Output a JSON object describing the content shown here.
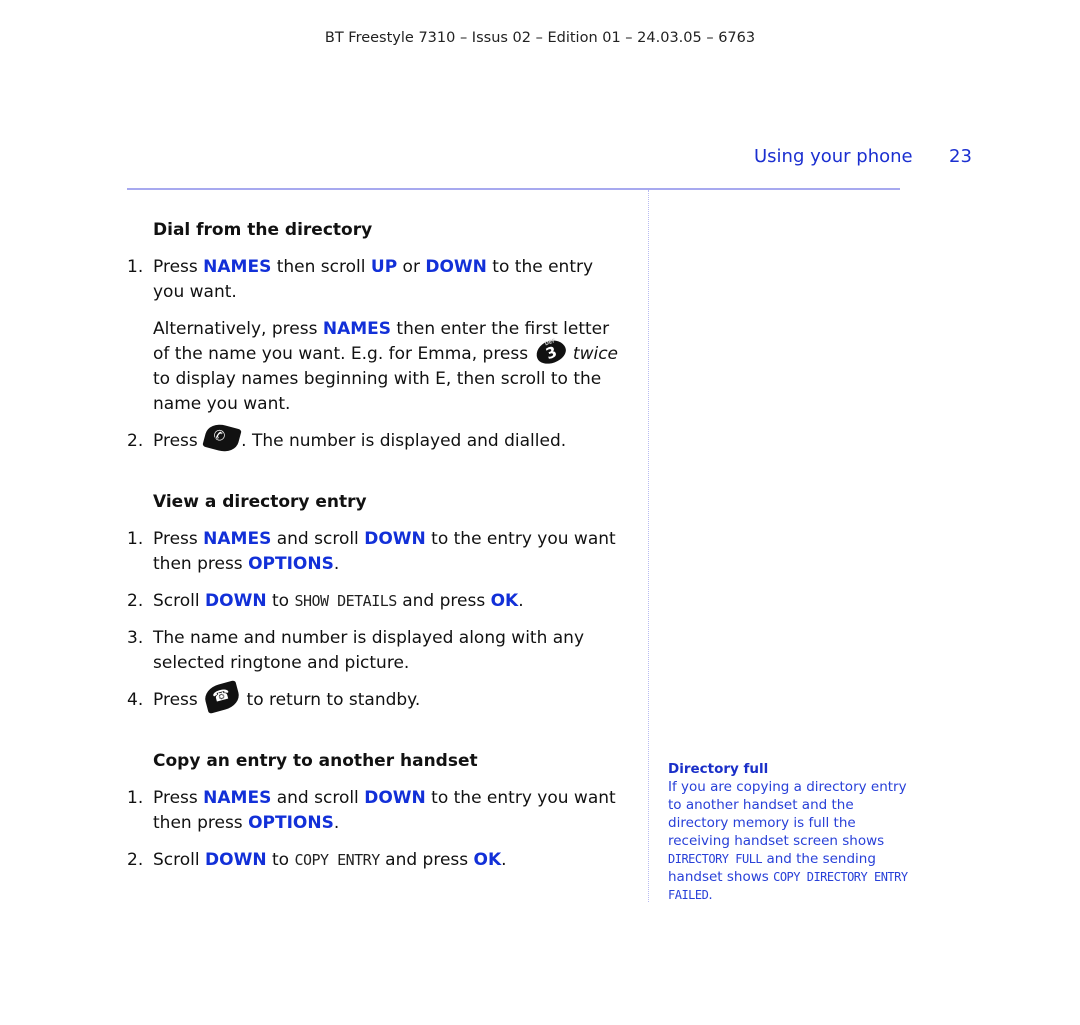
{
  "document": {
    "header_line": "BT Freestyle 7310 – Issus 02 – Edition 01 – 24.03.05 – 6763",
    "section_label": "Using your phone",
    "page_number": "23",
    "accent_color": "#1b2fd0"
  },
  "sections": [
    {
      "title": "Dial from the directory",
      "step1": {
        "num": "1.",
        "t1": "Press ",
        "k1": "NAMES",
        "t2": " then scroll ",
        "k2": "UP",
        "t3": " or ",
        "k3": "DOWN",
        "t4": " to the entry you want."
      },
      "alt": {
        "t1": "Alternatively, press ",
        "k1": "NAMES",
        "t2": " then enter the first letter of the name you want. E.g. for Emma, press ",
        "key_icon": "key-3-def-icon",
        "key_label": "3",
        "key_sub": "DEF",
        "t3_italic": "twice",
        "t4": " to display names beginning with E, then scroll to the name you want."
      },
      "step2": {
        "num": "2.",
        "t1": "Press ",
        "key_icon": "talk-key-icon",
        "t2": ". The number is displayed and dialled."
      }
    },
    {
      "title": "View a directory entry",
      "step1": {
        "num": "1.",
        "t1": "Press ",
        "k1": "NAMES",
        "t2": " and scroll ",
        "k2": "DOWN",
        "t3": " to the entry you want then press ",
        "k3": "OPTIONS",
        "t4": "."
      },
      "step2": {
        "num": "2.",
        "t1": "Scroll ",
        "k1": "DOWN",
        "t2": " to ",
        "lcd": "SHOW DETAILS",
        "t3": " and press ",
        "k2": "OK",
        "t4": "."
      },
      "step3": {
        "num": "3.",
        "text": "The name and number is displayed along with any selected ringtone and picture."
      },
      "step4": {
        "num": "4.",
        "t1": "Press ",
        "key_icon": "end-key-icon",
        "t2": " to return to standby."
      }
    },
    {
      "title": "Copy an entry to another handset",
      "step1": {
        "num": "1.",
        "t1": "Press ",
        "k1": "NAMES",
        "t2": " and scroll ",
        "k2": "DOWN",
        "t3": " to the entry you want then press ",
        "k3": "OPTIONS",
        "t4": "."
      },
      "step2": {
        "num": "2.",
        "t1": "Scroll ",
        "k1": "DOWN",
        "t2": " to ",
        "lcd": "COPY ENTRY",
        "t3": " and press ",
        "k2": "OK",
        "t4": "."
      }
    }
  ],
  "sidebar_note": {
    "title": "Directory full",
    "t1": "If you are copying a directory entry to another handset and the directory memory is full the receiving handset screen shows ",
    "lcd1": "DIRECTORY FULL",
    "t2": " and the sending handset shows ",
    "lcd2": "COPY DIRECTORY ENTRY FAILED",
    "t3": "."
  }
}
